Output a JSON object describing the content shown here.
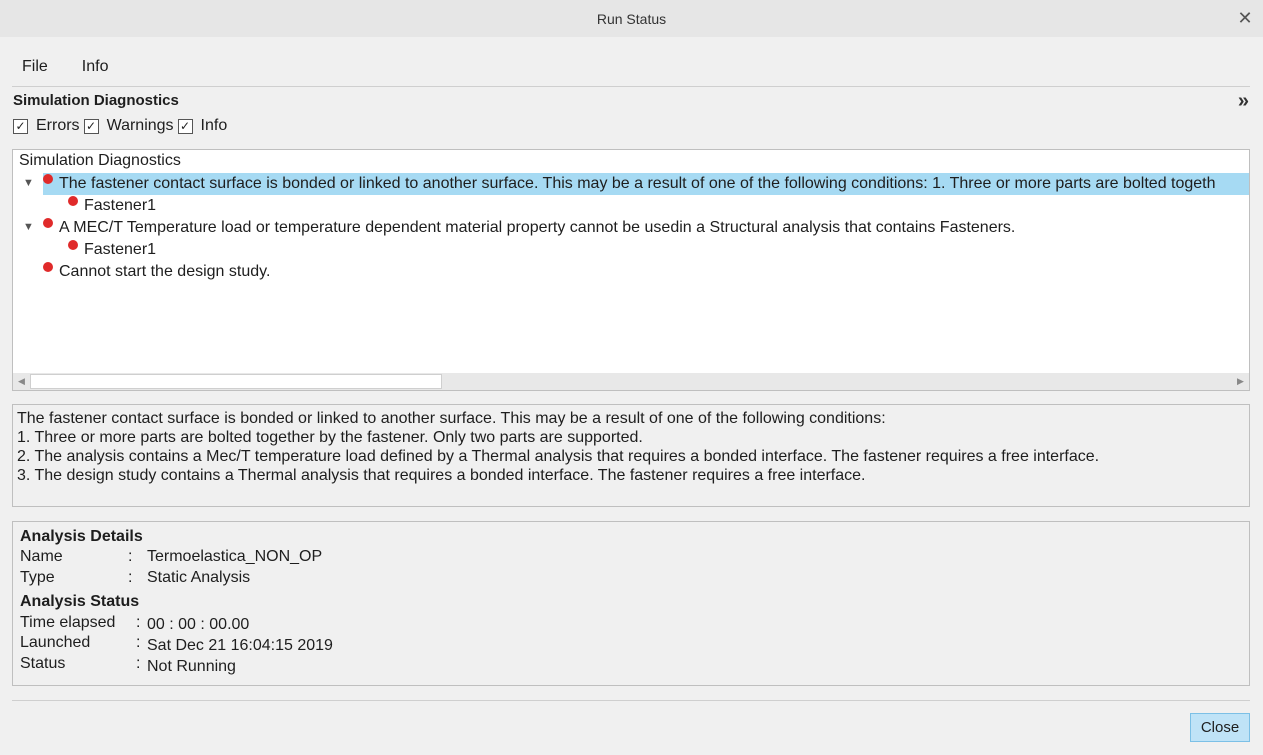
{
  "window": {
    "title": "Run Status",
    "close_glyph": "✕"
  },
  "menu": {
    "file": "File",
    "info": "Info"
  },
  "diagnostics": {
    "heading": "Simulation Diagnostics",
    "expand_glyph": "»",
    "filters": {
      "errors": {
        "label": "Errors",
        "checked": true
      },
      "warnings": {
        "label": "Warnings",
        "checked": true
      },
      "info": {
        "label": "Info",
        "checked": true
      }
    },
    "tree": {
      "root": "Simulation Diagnostics",
      "items": [
        {
          "text": "The fastener contact surface is bonded or linked to another surface. This may be a result of one of the following conditions: 1. Three or more parts are bolted togeth",
          "child": "Fastener1",
          "expanded": true,
          "selected": true
        },
        {
          "text": "A MEC/T Temperature load or temperature dependent material property cannot be usedin a Structural analysis that contains Fasteners.",
          "child": "Fastener1",
          "expanded": true,
          "selected": false
        },
        {
          "text": "Cannot start the design study."
        }
      ]
    },
    "message_lines": [
      "The fastener contact surface is bonded or linked to another surface. This may be a result of one of the following conditions:",
      "1. Three or more parts are bolted together by the fastener. Only two parts are supported.",
      "2. The analysis contains a Mec/T temperature load defined by a Thermal analysis that requires a bonded interface. The fastener requires a free interface.",
      "3. The design study contains a Thermal analysis that requires a bonded interface. The fastener requires a free interface."
    ]
  },
  "analysis_details": {
    "heading": "Analysis Details",
    "name_label": "Name",
    "name_value": "Termoelastica_NON_OP",
    "type_label": "Type",
    "type_value": "Static Analysis"
  },
  "analysis_status": {
    "heading": "Analysis Status",
    "elapsed_label": "Time elapsed",
    "elapsed_value": "00 : 00 : 00.00",
    "launched_label": "Launched",
    "launched_value": "Sat Dec 21 16:04:15 2019",
    "status_label": "Status",
    "status_value": "Not Running"
  },
  "separator": ":",
  "footer": {
    "close_label": "Close"
  },
  "colors": {
    "error_dot": "#e02a2a",
    "selection": "#a6daf3",
    "primary_button": "#bfe3f7"
  }
}
